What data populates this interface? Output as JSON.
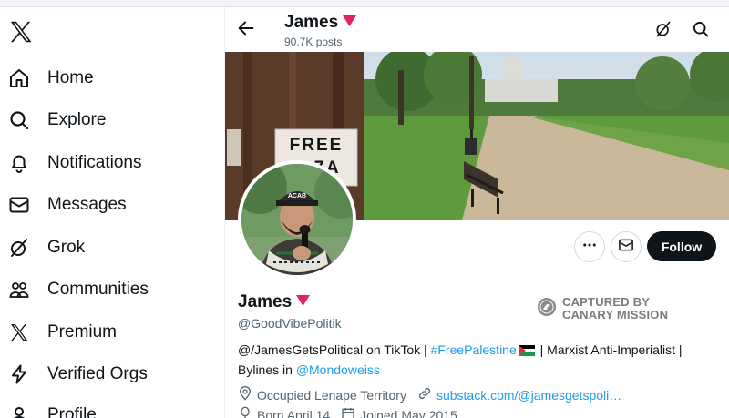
{
  "sidebar": {
    "items": [
      {
        "label": "Home",
        "icon": "home-icon"
      },
      {
        "label": "Explore",
        "icon": "search-icon"
      },
      {
        "label": "Notifications",
        "icon": "bell-icon"
      },
      {
        "label": "Messages",
        "icon": "envelope-icon"
      },
      {
        "label": "Grok",
        "icon": "grok-icon"
      },
      {
        "label": "Communities",
        "icon": "people-icon"
      },
      {
        "label": "Premium",
        "icon": "x-logo-icon"
      },
      {
        "label": "Verified Orgs",
        "icon": "lightning-icon"
      },
      {
        "label": "Profile",
        "icon": "person-icon"
      }
    ]
  },
  "header": {
    "name": "James",
    "posts": "90.7K posts"
  },
  "banner": {
    "sign_line1": "FREE",
    "sign_line2": "ZA"
  },
  "avatar": {
    "cap_text": "ACAB"
  },
  "actions": {
    "follow_label": "Follow"
  },
  "profile": {
    "name": "James",
    "handle": "@GoodVibePolitik",
    "stamp_line1": "CAPTURED BY",
    "stamp_line2": "CANARY MISSION",
    "bio_part1": "@/JamesGetsPolitical on TikTok | ",
    "bio_hashtag": "#FreePalestine",
    "bio_part2": " | Marxist Anti-Imperialist | Bylines in ",
    "bio_mention": "@Mondoweiss",
    "location": "Occupied Lenape Territory",
    "website": "substack.com/@jamesgetspoli…",
    "birthday": "Born April 14",
    "joined": "Joined May 2015"
  },
  "colors": {
    "accent": "#1d9bf0",
    "triangle": "#e0245e",
    "follow_bg": "#0f1419"
  }
}
